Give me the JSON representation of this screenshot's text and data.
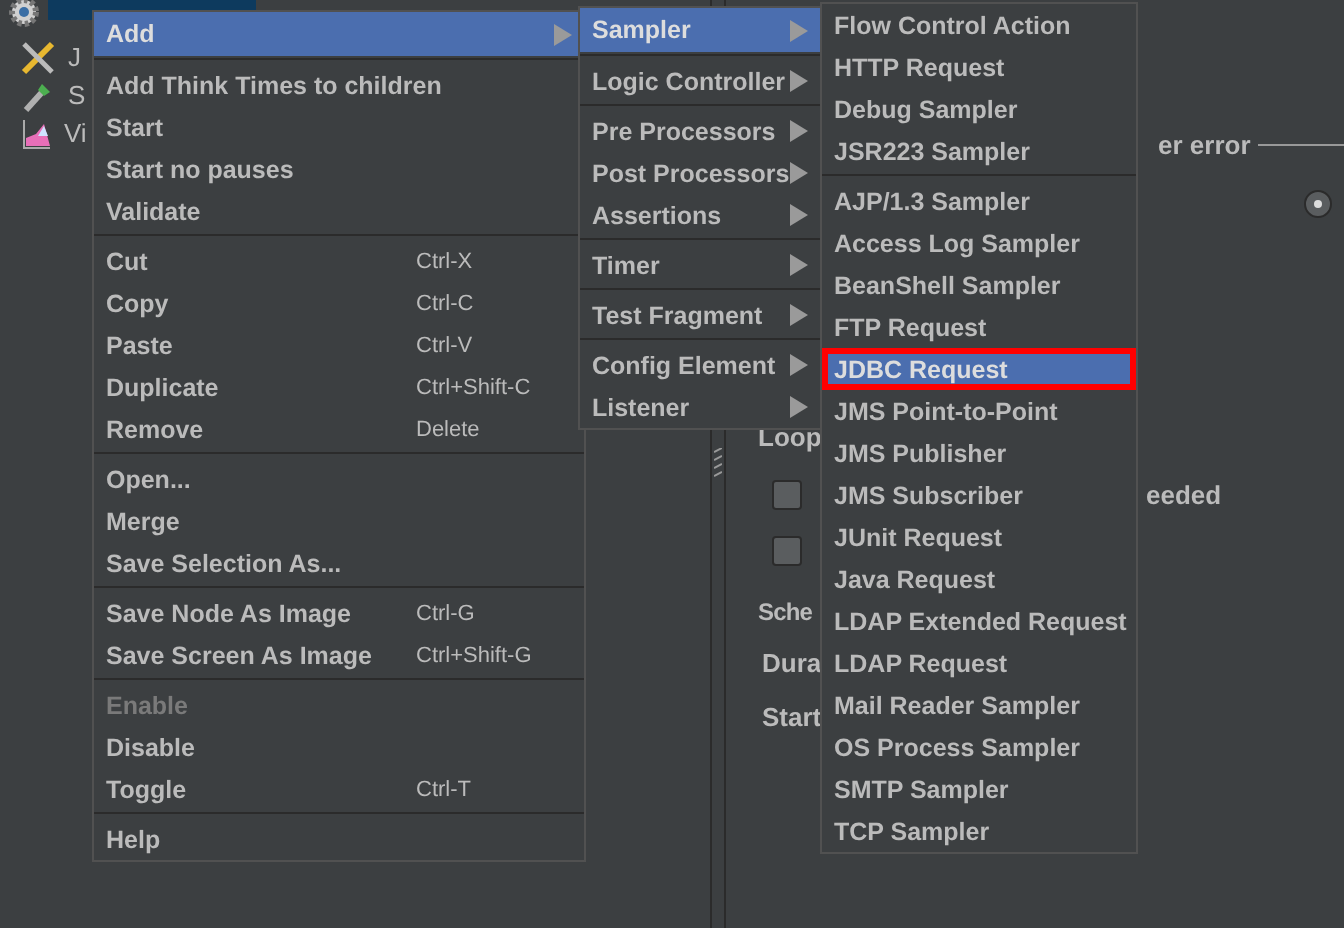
{
  "tree": {
    "items": [
      {
        "kind": "gear",
        "selected": true
      },
      {
        "label": "J",
        "kind": "tools",
        "selected": false
      },
      {
        "label": "S",
        "kind": "dropper",
        "selected": false
      },
      {
        "label": "Vi",
        "kind": "chart",
        "selected": false
      }
    ]
  },
  "background_panel": {
    "legend": "er error",
    "radio": {
      "selected": true
    },
    "loop_label": "Loop",
    "checkboxes": [
      {
        "label": "eeded",
        "checked": false
      },
      {
        "checked": false
      }
    ],
    "scheduler_legend": "Sche",
    "duration_label": "Dura",
    "start_label": "Start"
  },
  "context_menu": {
    "groups": [
      [
        {
          "label": "Add",
          "submenu": true,
          "selected": true,
          "disabled": false
        }
      ],
      [
        {
          "label": "Add Think Times to children",
          "submenu": false,
          "selected": false,
          "disabled": false
        },
        {
          "label": "Start",
          "submenu": false,
          "selected": false,
          "disabled": false
        },
        {
          "label": "Start no pauses",
          "submenu": false,
          "selected": false,
          "disabled": false
        },
        {
          "label": "Validate",
          "submenu": false,
          "selected": false,
          "disabled": false
        }
      ],
      [
        {
          "label": "Cut",
          "shortcut": "Ctrl-X",
          "submenu": false,
          "selected": false,
          "disabled": false
        },
        {
          "label": "Copy",
          "shortcut": "Ctrl-C",
          "submenu": false,
          "selected": false,
          "disabled": false
        },
        {
          "label": "Paste",
          "shortcut": "Ctrl-V",
          "submenu": false,
          "selected": false,
          "disabled": false
        },
        {
          "label": "Duplicate",
          "shortcut": "Ctrl+Shift-C",
          "submenu": false,
          "selected": false,
          "disabled": false
        },
        {
          "label": "Remove",
          "shortcut": "Delete",
          "submenu": false,
          "selected": false,
          "disabled": false
        }
      ],
      [
        {
          "label": "Open...",
          "submenu": false,
          "selected": false,
          "disabled": false
        },
        {
          "label": "Merge",
          "submenu": false,
          "selected": false,
          "disabled": false
        },
        {
          "label": "Save Selection As...",
          "submenu": false,
          "selected": false,
          "disabled": false
        }
      ],
      [
        {
          "label": "Save Node As Image",
          "shortcut": "Ctrl-G",
          "submenu": false,
          "selected": false,
          "disabled": false
        },
        {
          "label": "Save Screen As Image",
          "shortcut": "Ctrl+Shift-G",
          "submenu": false,
          "selected": false,
          "disabled": false
        }
      ],
      [
        {
          "label": "Enable",
          "submenu": false,
          "selected": false,
          "disabled": true
        },
        {
          "label": "Disable",
          "submenu": false,
          "selected": false,
          "disabled": false
        },
        {
          "label": "Toggle",
          "shortcut": "Ctrl-T",
          "submenu": false,
          "selected": false,
          "disabled": false
        }
      ],
      [
        {
          "label": "Help",
          "submenu": false,
          "selected": false,
          "disabled": false
        }
      ]
    ]
  },
  "add_submenu": {
    "groups": [
      [
        {
          "label": "Sampler",
          "submenu": true,
          "selected": true
        }
      ],
      [
        {
          "label": "Logic Controller",
          "submenu": true,
          "selected": false
        }
      ],
      [
        {
          "label": "Pre Processors",
          "submenu": true,
          "selected": false
        },
        {
          "label": "Post Processors",
          "submenu": true,
          "selected": false
        },
        {
          "label": "Assertions",
          "submenu": true,
          "selected": false
        }
      ],
      [
        {
          "label": "Timer",
          "submenu": true,
          "selected": false
        }
      ],
      [
        {
          "label": "Test Fragment",
          "submenu": true,
          "selected": false
        }
      ],
      [
        {
          "label": "Config Element",
          "submenu": true,
          "selected": false
        },
        {
          "label": "Listener",
          "submenu": true,
          "selected": false
        }
      ]
    ]
  },
  "sampler_submenu": {
    "groups": [
      [
        {
          "label": "Flow Control Action",
          "selected": false,
          "outlined": false
        },
        {
          "label": "HTTP Request",
          "selected": false,
          "outlined": false
        },
        {
          "label": "Debug Sampler",
          "selected": false,
          "outlined": false
        },
        {
          "label": "JSR223 Sampler",
          "selected": false,
          "outlined": false
        }
      ],
      [
        {
          "label": "AJP/1.3 Sampler",
          "selected": false,
          "outlined": false
        },
        {
          "label": "Access Log Sampler",
          "selected": false,
          "outlined": false
        },
        {
          "label": "BeanShell Sampler",
          "selected": false,
          "outlined": false
        },
        {
          "label": "FTP Request",
          "selected": false,
          "outlined": false
        },
        {
          "label": "JDBC Request",
          "selected": true,
          "outlined": true
        },
        {
          "label": "JMS Point-to-Point",
          "selected": false,
          "outlined": false
        },
        {
          "label": "JMS Publisher",
          "selected": false,
          "outlined": false
        },
        {
          "label": "JMS Subscriber",
          "selected": false,
          "outlined": false
        },
        {
          "label": "JUnit Request",
          "selected": false,
          "outlined": false
        },
        {
          "label": "Java Request",
          "selected": false,
          "outlined": false
        },
        {
          "label": "LDAP Extended Request",
          "selected": false,
          "outlined": false
        },
        {
          "label": "LDAP Request",
          "selected": false,
          "outlined": false
        },
        {
          "label": "Mail Reader Sampler",
          "selected": false,
          "outlined": false
        },
        {
          "label": "OS Process Sampler",
          "selected": false,
          "outlined": false
        },
        {
          "label": "SMTP Sampler",
          "selected": false,
          "outlined": false
        },
        {
          "label": "TCP Sampler",
          "selected": false,
          "outlined": false
        }
      ]
    ]
  }
}
